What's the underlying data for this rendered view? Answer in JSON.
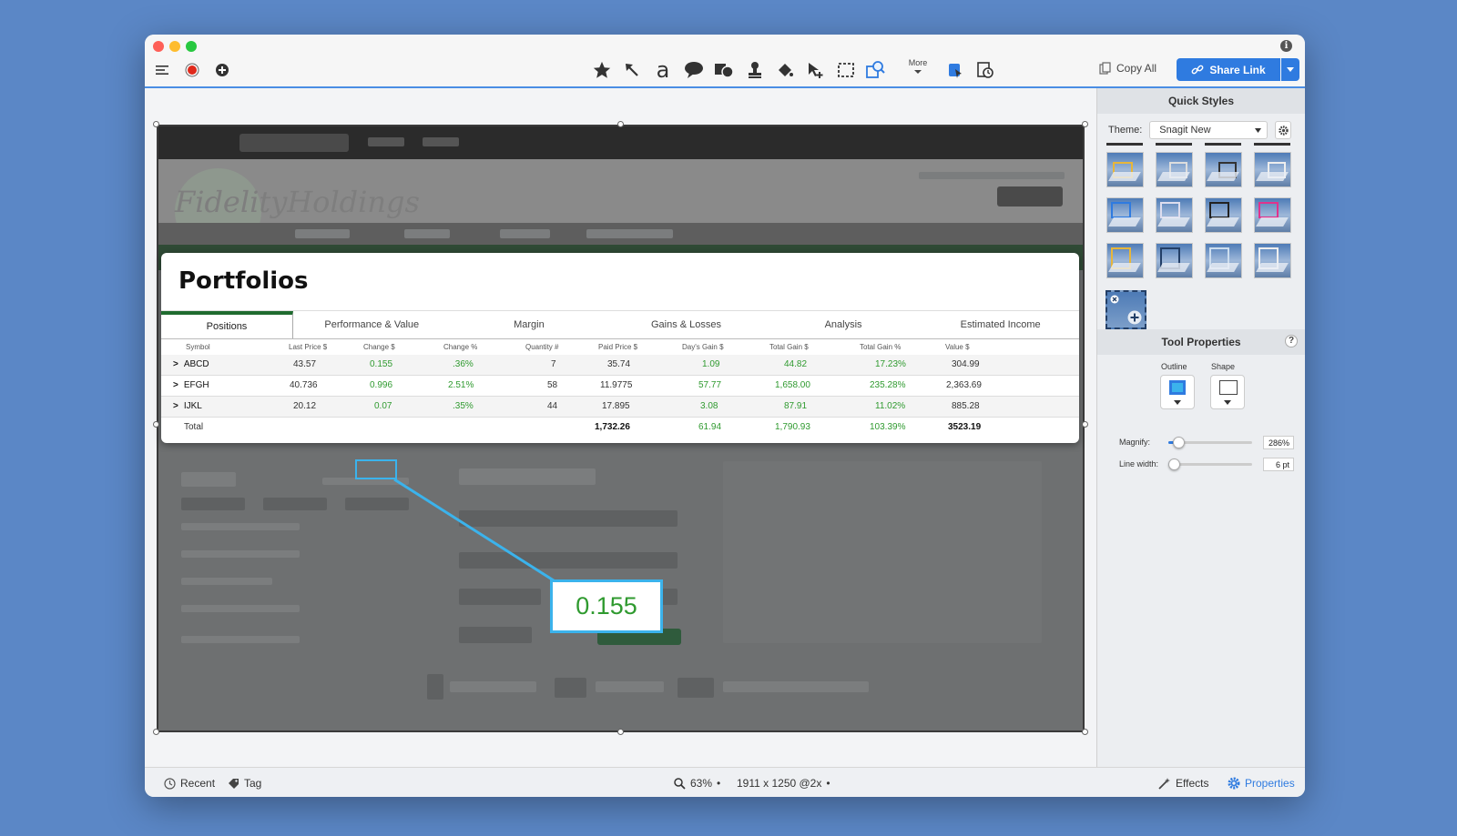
{
  "toolbar": {
    "more_label": "More",
    "copy_all_label": "Copy All",
    "share_link_label": "Share Link"
  },
  "portfolio": {
    "title": "Portfolios",
    "tabs": [
      "Positions",
      "Performance & Value",
      "Margin",
      "Gains & Losses",
      "Analysis",
      "Estimated Income"
    ],
    "columns": [
      "Symbol",
      "Last Price $",
      "Change $",
      "Change %",
      "Quantity #",
      "Paid Price $",
      "Day's Gain $",
      "Total Gain $",
      "Total Gain %",
      "Value $"
    ],
    "rows": [
      {
        "symbol": "ABCD",
        "last_price": "43.57",
        "change": "0.155",
        "change_pct": ".36%",
        "quantity": "7",
        "paid_price": "35.74",
        "days_gain": "1.09",
        "total_gain": "44.82",
        "total_gain_pct": "17.23%",
        "value": "304.99"
      },
      {
        "symbol": "EFGH",
        "last_price": "40.736",
        "change": "0.996",
        "change_pct": "2.51%",
        "quantity": "58",
        "paid_price": "11.9775",
        "days_gain": "57.77",
        "total_gain": "1,658.00",
        "total_gain_pct": "235.28%",
        "value": "2,363.69"
      },
      {
        "symbol": "IJKL",
        "last_price": "20.12",
        "change": "0.07",
        "change_pct": ".35%",
        "quantity": "44",
        "paid_price": "17.895",
        "days_gain": "3.08",
        "total_gain": "87.91",
        "total_gain_pct": "11.02%",
        "value": "885.28"
      }
    ],
    "total": {
      "label": "Total",
      "paid_price": "1,732.26",
      "days_gain": "61.94",
      "total_gain": "1,790.93",
      "total_gain_pct": "103.39%",
      "value": "3523.19"
    }
  },
  "magnifier": {
    "value": "0.155"
  },
  "capture_blurred": {
    "logo": "FidelityHoldings"
  },
  "statusbar": {
    "recent_label": "Recent",
    "tag_label": "Tag",
    "zoom": "63%",
    "dimensions": "1911 x 1250 @2x",
    "effects_label": "Effects",
    "properties_label": "Properties"
  },
  "sidebar": {
    "quick_styles_title": "Quick Styles",
    "theme_label": "Theme:",
    "theme_value": "Snagit New",
    "tool_properties_title": "Tool Properties",
    "outline_label": "Outline",
    "shape_label": "Shape",
    "magnify_label": "Magnify:",
    "magnify_value": "286%",
    "magnify_fraction": 0.12,
    "line_width_label": "Line width:",
    "line_width_value": "6 pt",
    "line_width_fraction": 0.06
  },
  "colors": {
    "accent": "#2f7be0",
    "callout": "#3bb3ec",
    "gain_green": "#2f9a2f",
    "background": "#5b87c6"
  }
}
